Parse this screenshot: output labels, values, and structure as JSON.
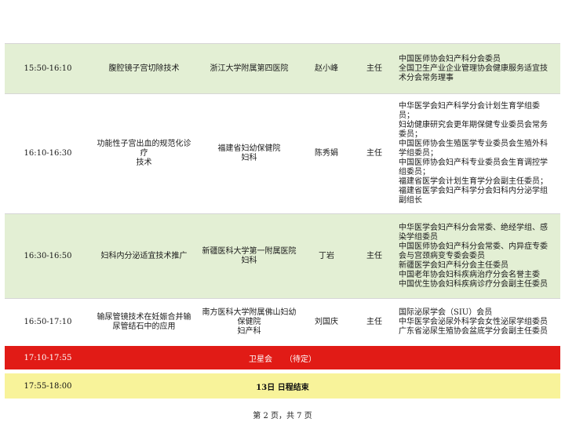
{
  "rows": [
    {
      "time": "15:50-16:10",
      "topic": [
        "腹腔镜子宫切除技术"
      ],
      "hospital": [
        "浙江大学附属第四医院"
      ],
      "name": "赵小峰",
      "title": "主任",
      "roles": [
        "中国医师协会妇产科分会委员",
        "全国卫生产业企业管理协会健康服务适宜技",
        "术分会常务理事"
      ]
    },
    {
      "time": "16:10-16:30",
      "topic": [
        "功能性子宫出血的规范化诊疗",
        "技术"
      ],
      "hospital": [
        "福建省妇幼保健院",
        "妇科"
      ],
      "name": "陈秀娟",
      "title": "主任",
      "roles": [
        "中华医学会妇产科学分会计划生育学组委",
        "员；",
        "妇幼健康研究会更年期保健专业委员会常务",
        "委员；",
        "中国医师协会生殖医学专业委员会生殖外科",
        "学组委员；",
        "中国医师协会妇产科专业委员会生育调控学",
        "组委员；",
        "福建省医学会计划生育学分会副主任委员；",
        "福建省医学会妇产科学分会妇科内分泌学组",
        "副组长"
      ]
    },
    {
      "time": "16:30-16:50",
      "topic": [
        "妇科内分泌适宜技术推广"
      ],
      "hospital": [
        "新疆医科大学第一附属医院",
        "妇科"
      ],
      "name": "丁岩",
      "title": "主任",
      "roles": [
        "中华医学会妇产科分会常委、绝经学组、感",
        "染学组委员",
        "中国医师协会妇产科分会常委、内异症专委",
        "会与宫颈病变专委会委员",
        "新疆医学会妇产科分会主任委员",
        "中国老年协会妇科疾病治疗分会名誉主委",
        "中国优生协会妇科疾病诊疗分会副主任委员"
      ]
    },
    {
      "time": "16:50-17:10",
      "topic": [
        "输尿管镜技术在妊娠合并输",
        "尿管结石中的应用"
      ],
      "hospital": [
        "南方医科大学附属佛山妇幼",
        "保健院",
        "妇产科"
      ],
      "name": "刘国庆",
      "title": "主任",
      "roles": [
        "国际泌尿学会（SIU）会员",
        "中华医学会泌尿外科学会女性泌尿学组委员",
        "广东省泌尿生殖协会盆底学分会副主任委员"
      ]
    }
  ],
  "satellite": {
    "time": "17:10-17:55",
    "label": "卫星会",
    "status": "（待定）"
  },
  "closing": {
    "time": "17:55-18:00",
    "label": "13日 日程结束"
  },
  "footer": "第 2 页，共 7 页",
  "colors": {
    "green": "#e3efd4",
    "red": "#e11b16",
    "yellow": "#f8f39a"
  }
}
